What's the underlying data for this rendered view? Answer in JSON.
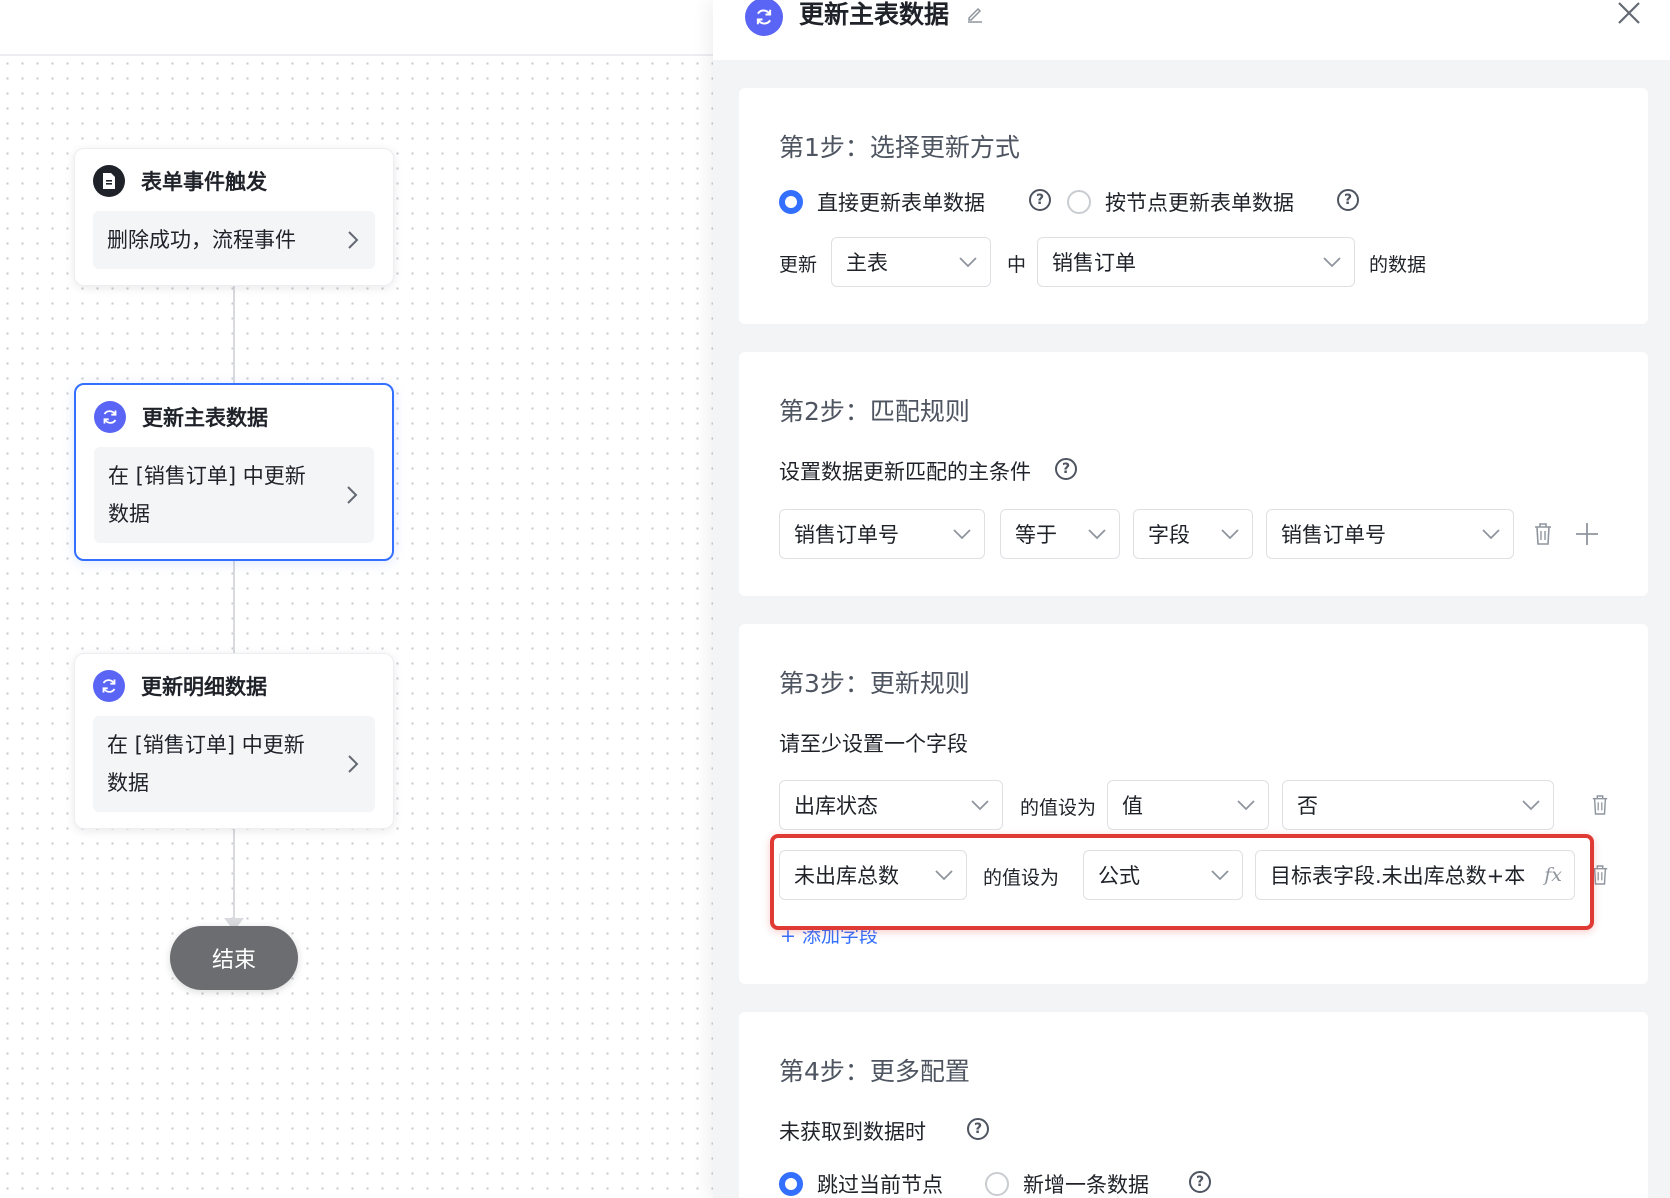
{
  "canvas": {
    "nodes": [
      {
        "title": "表单事件触发",
        "desc": "删除成功，流程事件",
        "icon": "document-icon"
      },
      {
        "title": "更新主表数据",
        "desc_line1": "在 [销售订单] 中更新",
        "desc_line2": "数据",
        "icon": "refresh-icon"
      },
      {
        "title": "更新明细数据",
        "desc_line1": "在 [销售订单] 中更新",
        "desc_line2": "数据",
        "icon": "refresh-icon"
      }
    ],
    "end_label": "结束"
  },
  "drawer": {
    "title": "更新主表数据",
    "step1": {
      "title": "第1步：选择更新方式",
      "option_direct": "直接更新表单数据",
      "option_node": "按节点更新表单数据",
      "update_label": "更新",
      "table_type": "主表",
      "middle_label": "中",
      "form_name": "销售订单",
      "suffix_label": "的数据"
    },
    "step2": {
      "title": "第2步：匹配规则",
      "subtitle": "设置数据更新匹配的主条件",
      "field": "销售订单号",
      "operator": "等于",
      "value_type": "字段",
      "value": "销售订单号"
    },
    "step3": {
      "title": "第3步：更新规则",
      "subtitle": "请至少设置一个字段",
      "rule1": {
        "field": "出库状态",
        "set_label": "的值设为",
        "type": "值",
        "value": "否"
      },
      "rule2": {
        "field": "未出库总数",
        "set_label": "的值设为",
        "type": "公式",
        "value": "目标表字段.未出库总数+本",
        "fx": "fx"
      },
      "add_field": "+ 添加字段"
    },
    "step4": {
      "title": "第4步：更多配置",
      "subtitle": "未获取到数据时",
      "option_skip": "跳过当前节点",
      "option_add": "新增一条数据"
    }
  },
  "colors": {
    "accent": "#3370ff",
    "node_icon": "#5b65f5",
    "highlight": "#e03a35",
    "end_node": "#6b6d70"
  }
}
